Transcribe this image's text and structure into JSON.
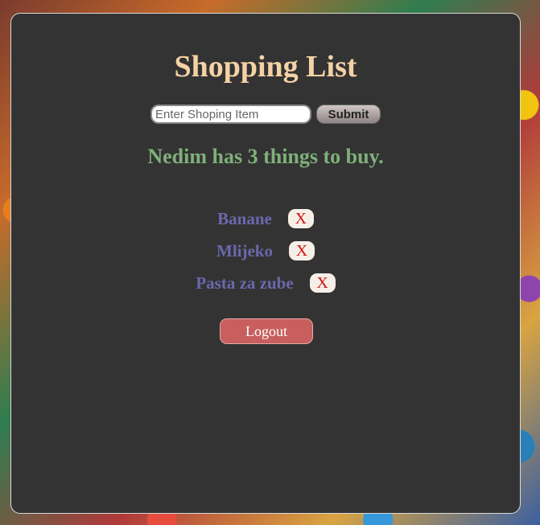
{
  "app": {
    "title": "Shopping List"
  },
  "form": {
    "input_placeholder": "Enter Shoping Item",
    "input_value": "",
    "submit_label": "Submit"
  },
  "summary": "Nedim has 3 things to buy.",
  "items": [
    {
      "label": "Banane",
      "remove_label": "X"
    },
    {
      "label": "Mlijeko",
      "remove_label": "X"
    },
    {
      "label": "Pasta za zube",
      "remove_label": "X"
    }
  ],
  "logout_label": "Logout",
  "colors": {
    "panel": "#333333",
    "title": "#f5d2a6",
    "summary": "#7fb07a",
    "item": "#6b68ad",
    "remove": "#d11212",
    "logout": "#c85e5e"
  }
}
